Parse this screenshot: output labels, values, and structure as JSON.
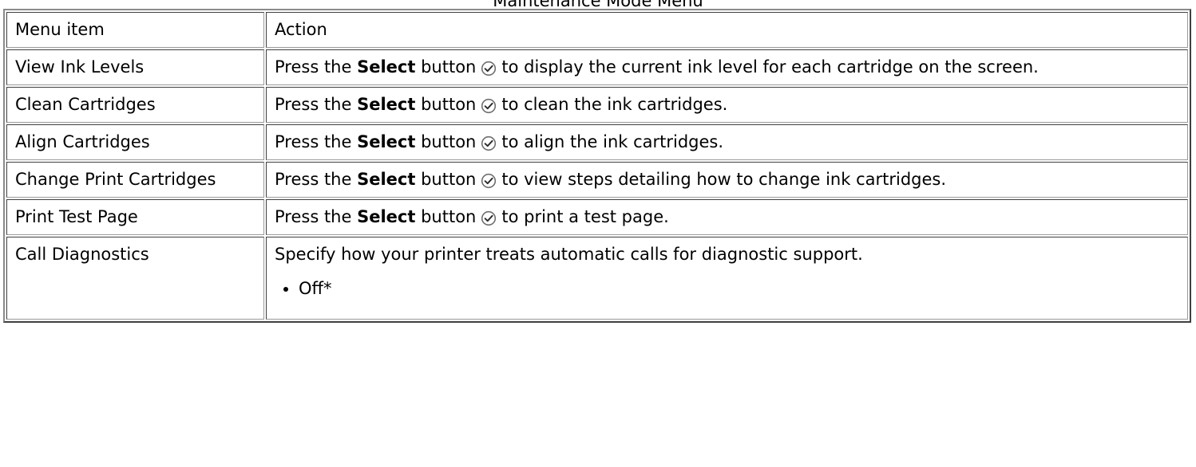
{
  "caption": "Maintenance Mode Menu",
  "header": {
    "item_label": "Menu item",
    "action_label": "Action"
  },
  "rows": [
    {
      "item": "View Ink Levels",
      "action_before": "Press the",
      "action_bold": "Select",
      "action_mid": "button",
      "action_after": "to display the current ink level for each cartridge on the screen."
    },
    {
      "item": "Clean Cartridges",
      "action_before": "Press the",
      "action_bold": "Select",
      "action_mid": "button",
      "action_after": "to clean the ink cartridges."
    },
    {
      "item": "Align Cartridges",
      "action_before": "Press the",
      "action_bold": "Select",
      "action_mid": "button",
      "action_after": "to align the ink cartridges."
    },
    {
      "item": "Change Print Cartridges",
      "action_before": "Press the",
      "action_bold": "Select",
      "action_mid": "button",
      "action_after": "to view steps detailing how to change ink cartridges."
    },
    {
      "item": "Print Test Page",
      "action_before": "Press the",
      "action_bold": "Select",
      "action_mid": "button",
      "action_after": "to print a test page."
    },
    {
      "item": "Call Diagnostics",
      "action_text": "Specify how your printer treats automatic calls for diagnostic support.",
      "options": [
        "Off*"
      ]
    }
  ],
  "icons": {
    "select_button": "checkmark-circle-icon"
  }
}
